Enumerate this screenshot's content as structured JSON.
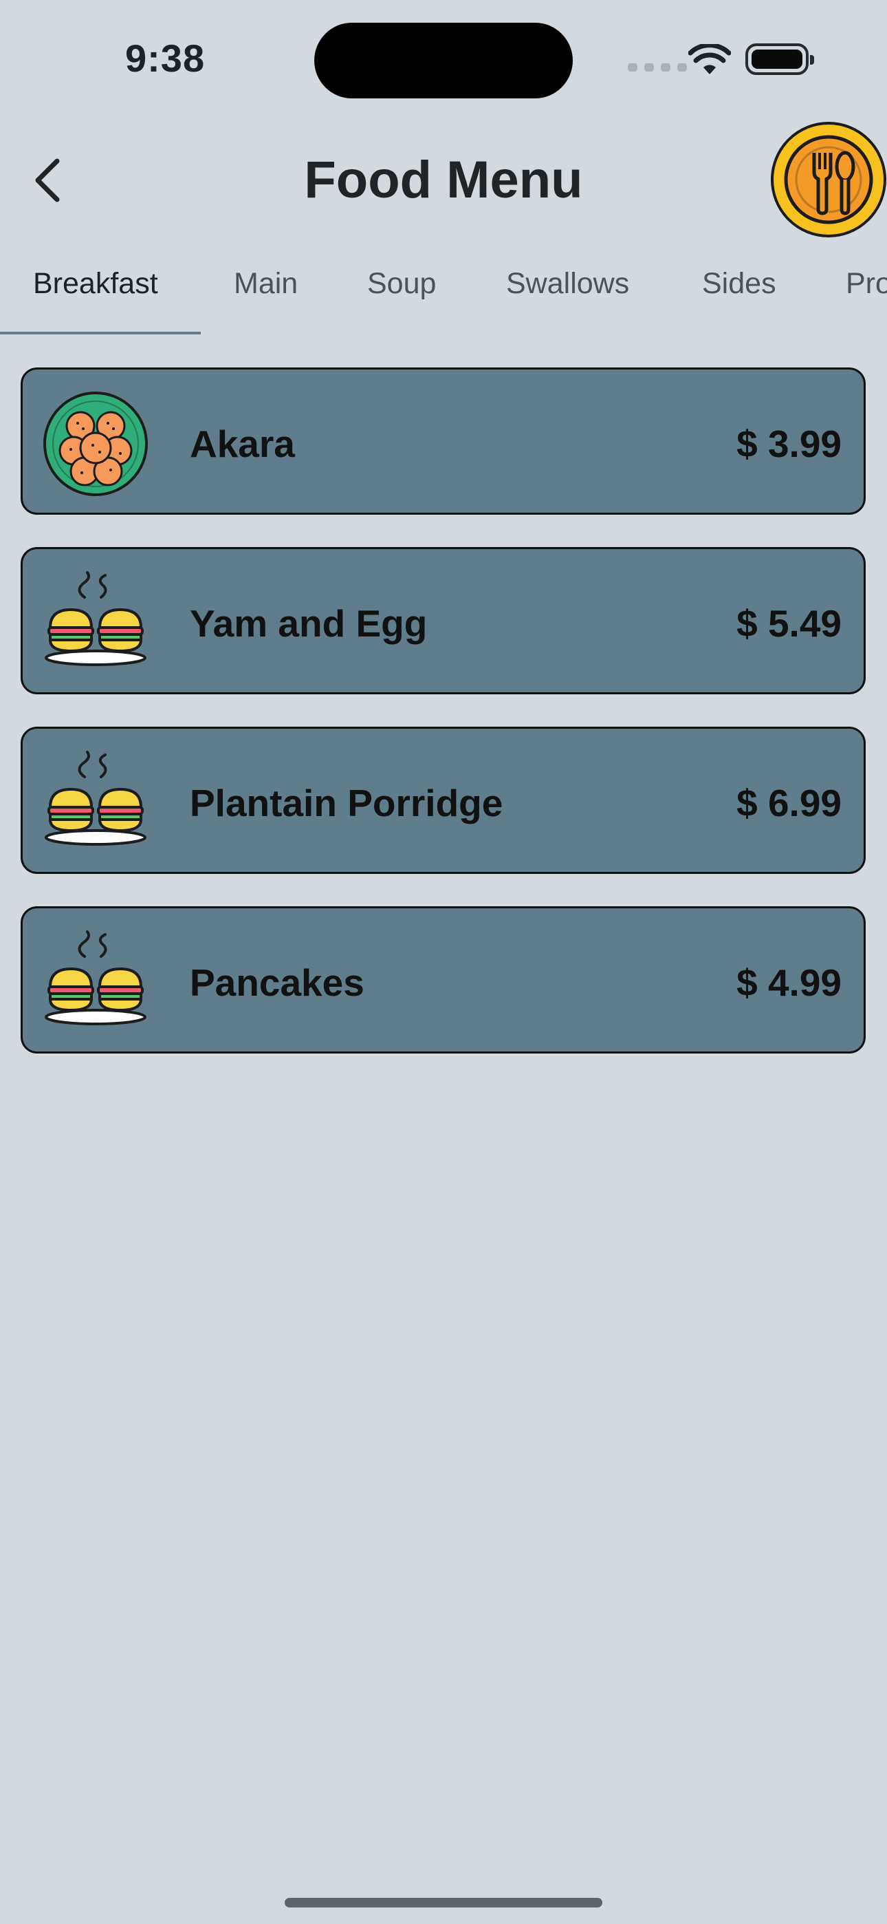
{
  "status_bar": {
    "time": "9:38"
  },
  "header": {
    "title": "Food Menu"
  },
  "tabs": [
    {
      "label": "Breakfast",
      "active": true
    },
    {
      "label": "Main"
    },
    {
      "label": "Soup"
    },
    {
      "label": "Swallows"
    },
    {
      "label": "Sides"
    },
    {
      "label": "Pro"
    }
  ],
  "menu_items": [
    {
      "name": "Akara",
      "price": "$ 3.99",
      "icon": "akara-plate-icon"
    },
    {
      "name": "Yam and Egg",
      "price": "$ 5.49",
      "icon": "burgers-plate-icon"
    },
    {
      "name": "Plantain Porridge",
      "price": "$ 6.99",
      "icon": "burgers-plate-icon"
    },
    {
      "name": "Pancakes",
      "price": "$ 4.99",
      "icon": "burgers-plate-icon"
    }
  ],
  "colors": {
    "background": "#d2d9df",
    "card": "#607d8b",
    "accent": "#607d8b",
    "logo": "#f7c21e"
  }
}
